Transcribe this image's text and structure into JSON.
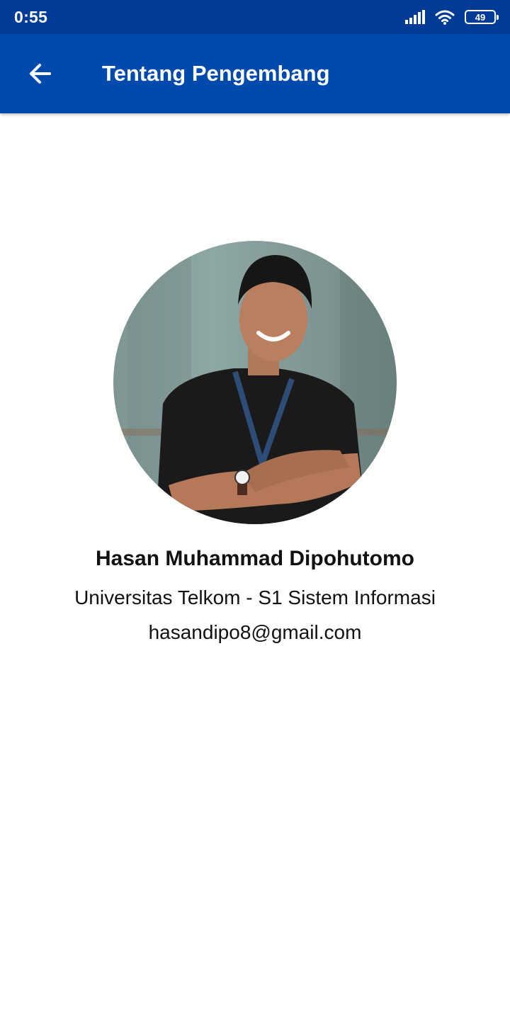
{
  "status_bar": {
    "time": "0:55",
    "battery_level": "49",
    "icons": [
      "signal-icon",
      "wifi-icon",
      "battery-icon"
    ]
  },
  "app_bar": {
    "title": "Tentang Pengembang",
    "back_icon": "arrow-left-icon",
    "background": "#004aad"
  },
  "developer": {
    "name": "Hasan Muhammad Dipohutomo",
    "school": "Universitas Telkom - S1 Sistem Informasi",
    "email": "hasandipo8@gmail.com"
  },
  "colors": {
    "status_bar": "#003c96",
    "app_bar": "#004aad",
    "text": "#111111"
  }
}
